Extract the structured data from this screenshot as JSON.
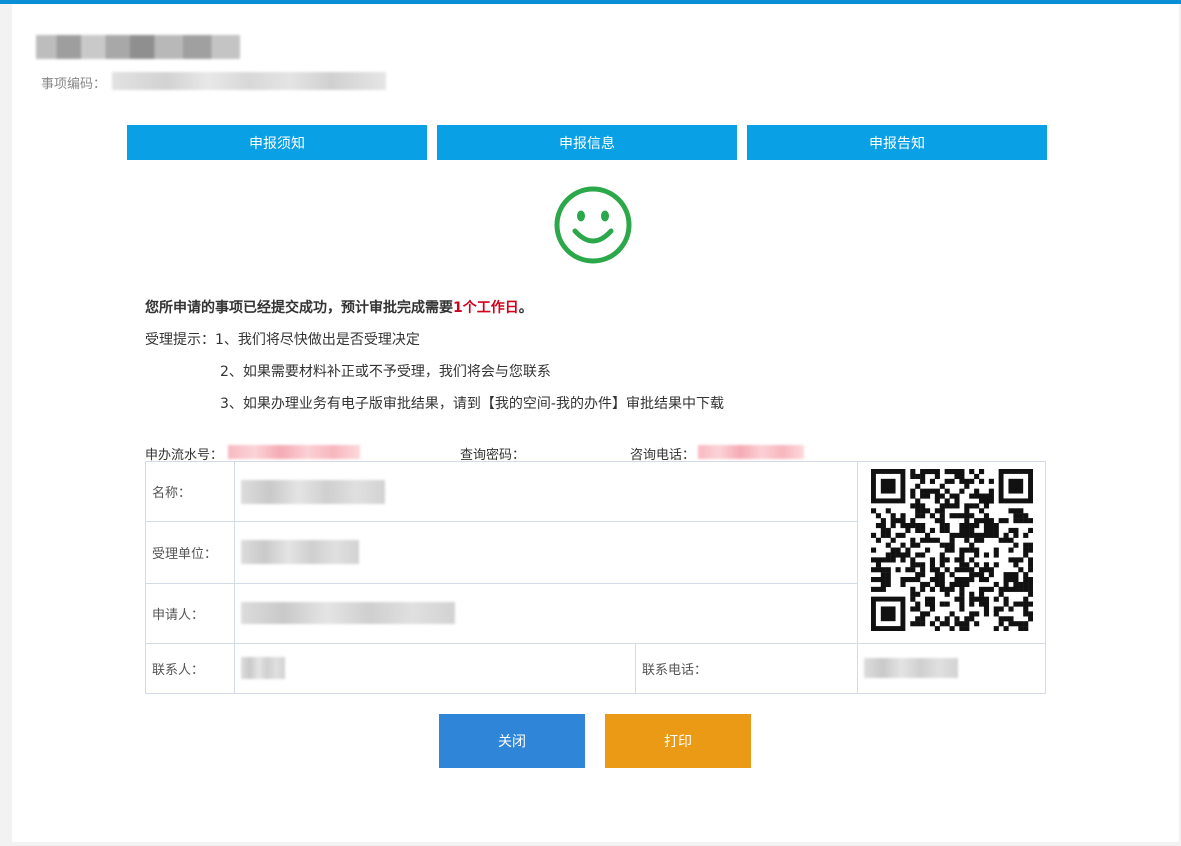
{
  "header": {
    "code_label": "事项编码："
  },
  "tabs": [
    {
      "label": "申报须知"
    },
    {
      "label": "申报信息"
    },
    {
      "label": "申报告知"
    }
  ],
  "result": {
    "message_prefix": "您所申请的事项已经提交成功，预计审批完成需要",
    "message_highlight": "1个工作日",
    "message_suffix": "。",
    "tip_label": "受理提示：",
    "tips": [
      "1、我们将尽快做出是否受理决定",
      "2、如果需要材料补正或不予受理，我们将会与您联系",
      "3、如果办理业务有电子版审批结果，请到【我的空间-我的办件】审批结果中下载"
    ]
  },
  "meta": {
    "serial_label": "申办流水号：",
    "password_label": "查询密码：",
    "phone_label": "咨询电话："
  },
  "info_table": {
    "name_label": "名称：",
    "unit_label": "受理单位：",
    "applicant_label": "申请人：",
    "contact_label": "联系人：",
    "contact_phone_label": "联系电话："
  },
  "buttons": {
    "close": "关闭",
    "print": "打印"
  },
  "colors": {
    "accent": "#0aa0e6",
    "success": "#2aa84a",
    "highlight": "#d0021b",
    "close_button": "#2f86d9",
    "print_button": "#ea9a14"
  },
  "icons": {
    "status": "smiley-icon",
    "qr": "qr-code-icon"
  }
}
